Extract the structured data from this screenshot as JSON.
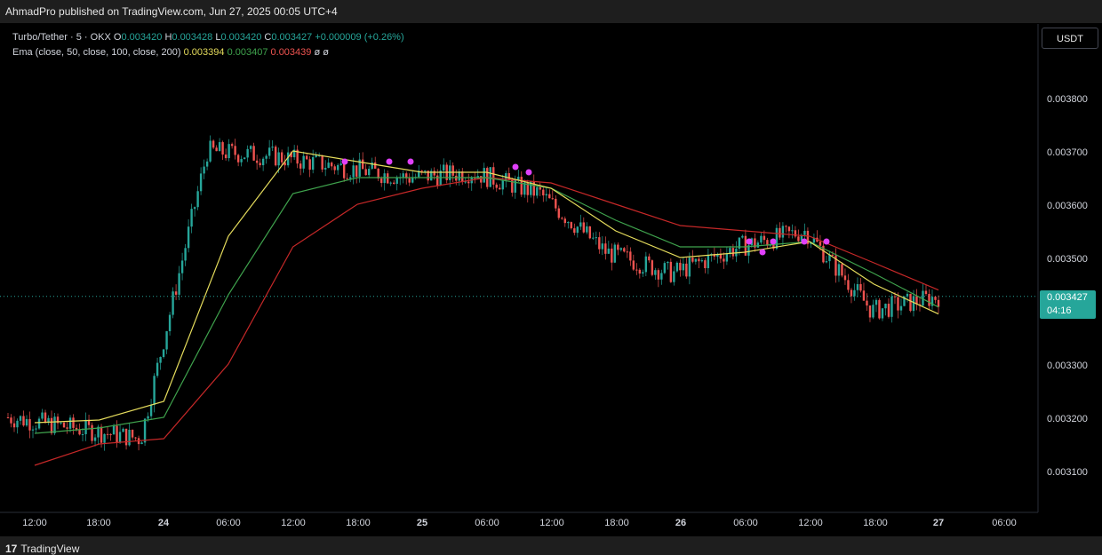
{
  "header": {
    "published": "AhmadPro published on TradingView.com, Jun 27, 2025 00:05 UTC+4"
  },
  "legend": {
    "symbol": "Turbo/Tether · 5 · OKX",
    "o_label": "O",
    "o": "0.003420",
    "h_label": "H",
    "h": "0.003428",
    "l_label": "L",
    "l": "0.003420",
    "c_label": "C",
    "c": "0.003427",
    "change": "+0.000009 (+0.26%)",
    "ema_label": "Ema (close, 50, close, 100, close, 200)",
    "ema50": "0.003394",
    "ema100": "0.003407",
    "ema200": "0.003439",
    "extra1": "ø",
    "extra2": "ø"
  },
  "currency_button": "USDT",
  "price_badge": {
    "price": "0.003427",
    "countdown": "04:16"
  },
  "y_axis_ticks": [
    "0.003800",
    "0.003700",
    "0.003600",
    "0.003500",
    "0.003300",
    "0.003200",
    "0.003100"
  ],
  "x_axis_ticks": [
    {
      "label": "12:00",
      "bold": false
    },
    {
      "label": "18:00",
      "bold": false
    },
    {
      "label": "24",
      "bold": true
    },
    {
      "label": "06:00",
      "bold": false
    },
    {
      "label": "12:00",
      "bold": false
    },
    {
      "label": "18:00",
      "bold": false
    },
    {
      "label": "25",
      "bold": true
    },
    {
      "label": "06:00",
      "bold": false
    },
    {
      "label": "12:00",
      "bold": false
    },
    {
      "label": "18:00",
      "bold": false
    },
    {
      "label": "26",
      "bold": true
    },
    {
      "label": "06:00",
      "bold": false
    },
    {
      "label": "12:00",
      "bold": false
    },
    {
      "label": "18:00",
      "bold": false
    },
    {
      "label": "27",
      "bold": true
    },
    {
      "label": "06:00",
      "bold": false
    }
  ],
  "footer": {
    "brand": "TradingView"
  },
  "colors": {
    "up": "#26a69a",
    "down": "#ef5350",
    "ema50": "#e5dc5c",
    "ema100": "#3fa34d",
    "ema200": "#c62828",
    "marker": "#e040fb",
    "last_price_line": "#26a69a"
  },
  "chart_data": {
    "type": "line",
    "title": "Turbo/Tether · 5 · OKX",
    "ylim": [
      0.00305,
      0.00387
    ],
    "x": [
      "23 12:00",
      "23 18:00",
      "24 00:00",
      "24 06:00",
      "24 12:00",
      "24 18:00",
      "25 00:00",
      "25 06:00",
      "25 12:00",
      "25 18:00",
      "26 00:00",
      "26 06:00",
      "26 12:00",
      "26 18:00",
      "27 00:00"
    ],
    "series": [
      {
        "name": "close",
        "values": [
          0.0032,
          0.00318,
          0.00316,
          0.0037,
          0.00369,
          0.00367,
          0.00365,
          0.00366,
          0.00362,
          0.00351,
          0.00347,
          0.00352,
          0.00355,
          0.0034,
          0.003427
        ]
      },
      {
        "name": "EMA 50",
        "values": [
          0.00319,
          0.003195,
          0.00323,
          0.00354,
          0.0037,
          0.00368,
          0.00366,
          0.00366,
          0.00363,
          0.00355,
          0.0035,
          0.00351,
          0.00353,
          0.00345,
          0.003394
        ]
      },
      {
        "name": "EMA 100",
        "values": [
          0.00317,
          0.00318,
          0.0032,
          0.00343,
          0.00362,
          0.00365,
          0.00365,
          0.00365,
          0.00363,
          0.00357,
          0.00352,
          0.00352,
          0.00353,
          0.00347,
          0.003407
        ]
      },
      {
        "name": "EMA 200",
        "values": [
          0.00311,
          0.00315,
          0.00316,
          0.0033,
          0.00352,
          0.0036,
          0.00363,
          0.00365,
          0.00364,
          0.0036,
          0.00356,
          0.00355,
          0.00354,
          0.00349,
          0.003439
        ]
      }
    ],
    "markers": [
      0.00368,
      0.00368,
      0.00368,
      0.00367,
      0.00366,
      0.00353,
      0.00351,
      0.00353,
      0.00353,
      0.00353
    ],
    "last_price": 0.003427,
    "grid": false
  }
}
